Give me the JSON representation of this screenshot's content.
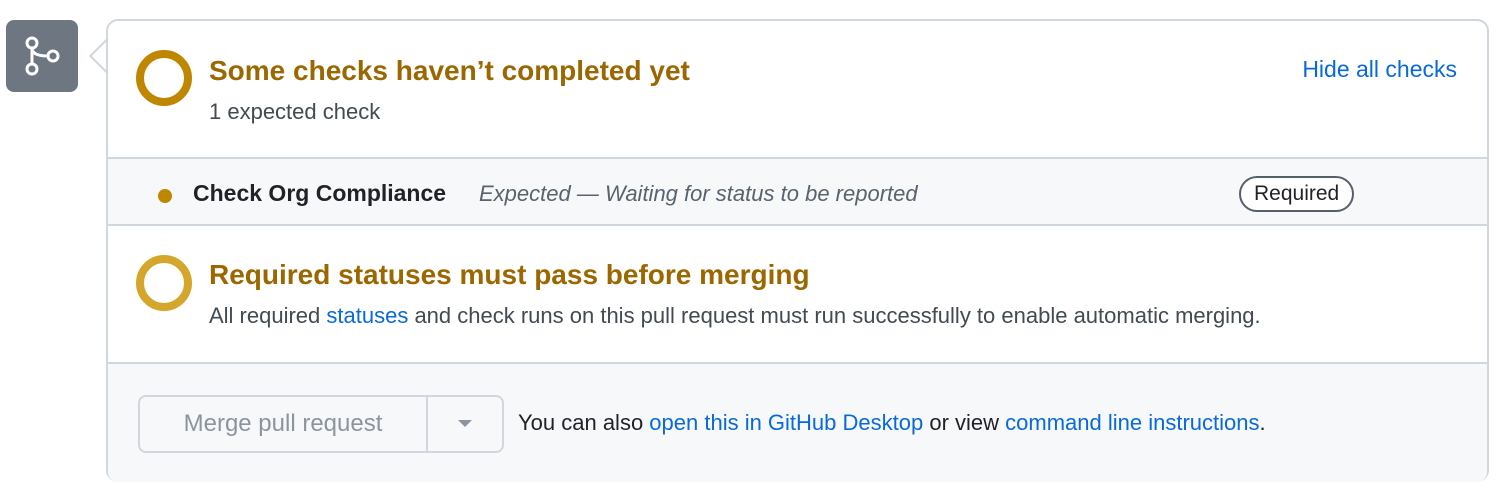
{
  "checks": {
    "title": "Some checks haven’t completed yet",
    "subtitle": "1 expected check",
    "hide_link": "Hide all checks",
    "items": [
      {
        "name": "Check Org Compliance",
        "description": "Expected — Waiting for status to be reported",
        "badge": "Required",
        "status_color": "#bf8700"
      }
    ]
  },
  "required": {
    "title": "Required statuses must pass before merging",
    "text_before": "All required ",
    "link": "statuses",
    "text_after": " and check runs on this pull request must run successfully to enable automatic merging."
  },
  "merge": {
    "button_label": "Merge pull request",
    "dropdown_icon": "triangle-down-icon",
    "note_prefix": "You can also ",
    "desktop_link": "open this in GitHub Desktop",
    "note_middle": " or view ",
    "cli_link": "command line instructions",
    "note_suffix": "."
  },
  "icons": {
    "merge_badge": "git-branch-icon",
    "pending_ring": "pending-ring-icon"
  },
  "colors": {
    "pending": "#bf8700",
    "title": "#9a6700",
    "link": "#0969da",
    "badge_bg": "#6e7781"
  }
}
